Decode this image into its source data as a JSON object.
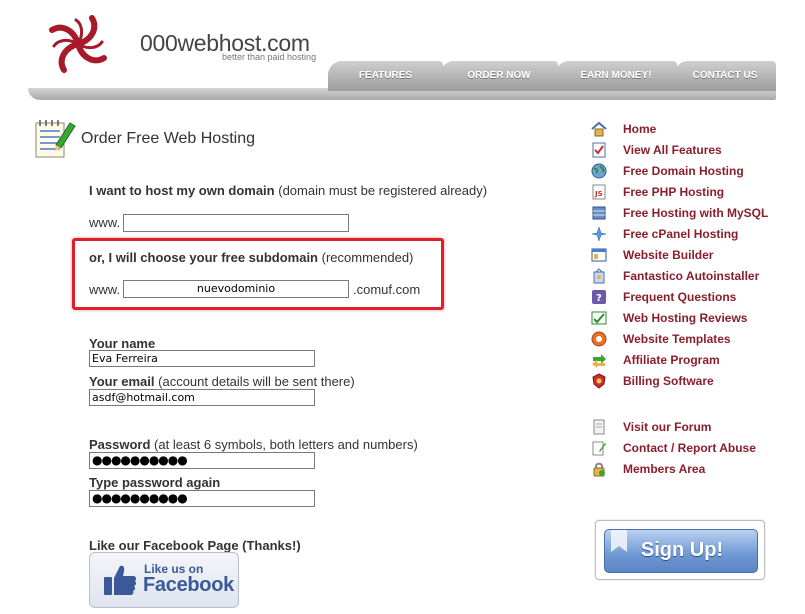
{
  "header": {
    "logo_name": "000webhost.com",
    "logo_tagline": "better than paid hosting",
    "logo_color": "#a8192a",
    "nav": [
      "FEATURES",
      "ORDER NOW",
      "EARN MONEY!",
      "CONTACT US"
    ]
  },
  "main": {
    "title": "Order Free Web Hosting",
    "own_domain": {
      "label": "I want to host my own domain",
      "note": "(domain must be registered already)",
      "prefix": "www.",
      "value": ""
    },
    "subdomain": {
      "label": "or, I will choose your free subdomain",
      "note": "(recommended)",
      "prefix": "www.",
      "value": "nuevodominio",
      "suffix": ".comuf.com",
      "highlight_color": "#e01e2a"
    },
    "name": {
      "label": "Your name",
      "value": "Eva Ferreira"
    },
    "email": {
      "label": "Your email",
      "note": "(account details will be sent there)",
      "value": "asdf@hotmail.com"
    },
    "password": {
      "label": "Password",
      "note": "(at least 6 symbols, both letters and numbers)",
      "value": "●●●●●●●●●●"
    },
    "password_again": {
      "label": "Type password again",
      "value": "●●●●●●●●●●"
    },
    "facebook": {
      "label": "Like our Facebook Page (Thanks!)",
      "button_line1": "Like us on",
      "button_line2": "Facebook",
      "color": "#3b5998"
    }
  },
  "sidebar": {
    "link_color": "#8a1f2c",
    "items": [
      {
        "label": "Home",
        "icon": "home-icon"
      },
      {
        "label": "View All Features",
        "icon": "checklist-icon"
      },
      {
        "label": "Free Domain Hosting",
        "icon": "globe-icon"
      },
      {
        "label": "Free PHP Hosting",
        "icon": "php-file-icon"
      },
      {
        "label": "Free Hosting with MySQL",
        "icon": "database-icon"
      },
      {
        "label": "Free cPanel Hosting",
        "icon": "cpanel-icon"
      },
      {
        "label": "Website Builder",
        "icon": "builder-icon"
      },
      {
        "label": "Fantastico Autoinstaller",
        "icon": "installer-icon"
      },
      {
        "label": "Frequent Questions",
        "icon": "question-icon"
      },
      {
        "label": "Web Hosting Reviews",
        "icon": "reviews-icon"
      },
      {
        "label": "Website Templates",
        "icon": "templates-icon"
      },
      {
        "label": "Affiliate Program",
        "icon": "affiliate-icon"
      },
      {
        "label": "Billing Software",
        "icon": "billing-icon"
      }
    ],
    "secondary_items": [
      {
        "label": "Visit our Forum",
        "icon": "forum-icon"
      },
      {
        "label": "Contact / Report Abuse",
        "icon": "contact-icon"
      },
      {
        "label": "Members Area",
        "icon": "lock-icon"
      }
    ],
    "signup_label": "Sign Up!"
  }
}
